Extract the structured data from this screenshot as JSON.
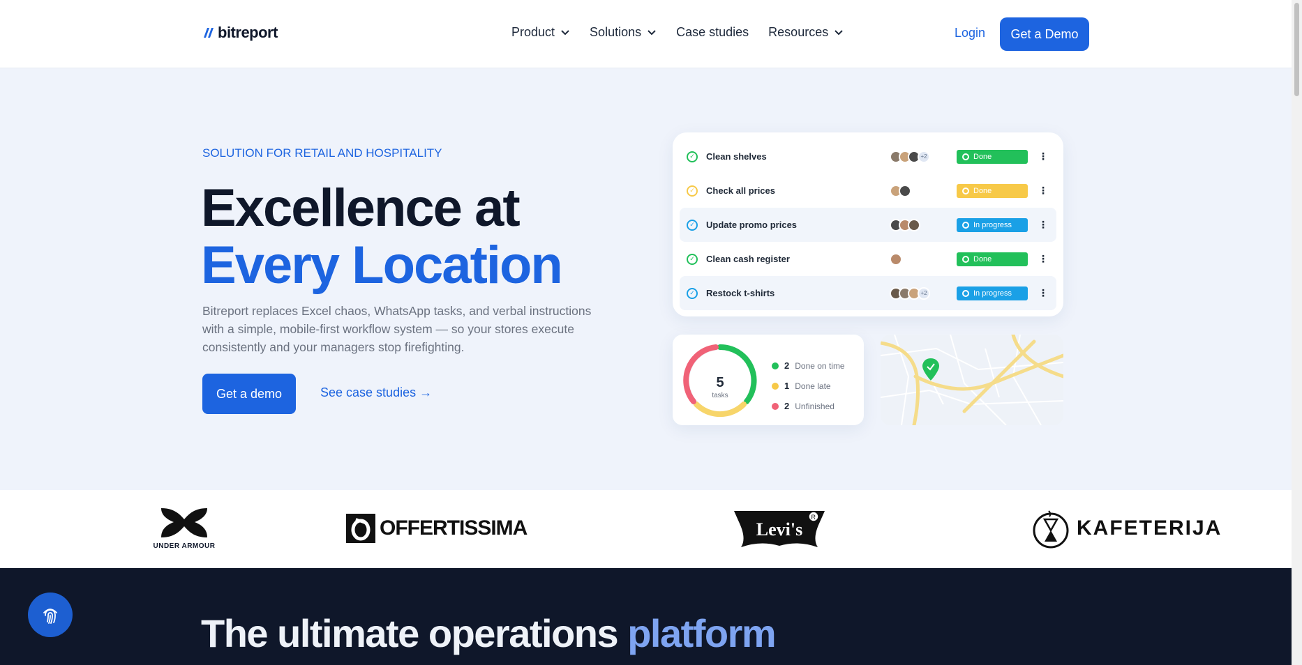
{
  "brand": {
    "logo_text": "bitreport"
  },
  "nav": {
    "items": [
      {
        "label": "Product",
        "dropdown": true
      },
      {
        "label": "Solutions",
        "dropdown": true
      },
      {
        "label": "Case studies",
        "dropdown": false
      },
      {
        "label": "Resources",
        "dropdown": true
      }
    ],
    "login": "Login",
    "demo": "Get a Demo"
  },
  "hero": {
    "eyebrow": "SOLUTION FOR RETAIL AND HOSPITALITY",
    "headline_line1": "Excellence at",
    "headline_line2": "Every Location",
    "lede": "Bitreport replaces Excel chaos, WhatsApp tasks, and verbal instructions with a simple, mobile-first workflow system — so your stores execute consistently and your managers stop firefighting.",
    "primary_cta": "Get a demo",
    "secondary_cta": "See case studies →"
  },
  "tasks": [
    {
      "name": "Clean shelves",
      "status": "Done",
      "status_color": "#22c05a",
      "check_color": "#22c05a",
      "avatars": 3,
      "more": "+2",
      "highlight": false
    },
    {
      "name": "Check all prices",
      "status": "Done",
      "status_color": "#f7c948",
      "check_color": "#f7c948",
      "avatars": 2,
      "more": "",
      "highlight": false
    },
    {
      "name": "Update promo prices",
      "status": "In progress",
      "status_color": "#1aa0e6",
      "check_color": "#1aa0e6",
      "avatars": 3,
      "more": "",
      "highlight": true
    },
    {
      "name": "Clean cash register",
      "status": "Done",
      "status_color": "#22c05a",
      "check_color": "#22c05a",
      "avatars": 1,
      "more": "",
      "highlight": false
    },
    {
      "name": "Restock t-shirts",
      "status": "In progress",
      "status_color": "#1aa0e6",
      "check_color": "#1aa0e6",
      "avatars": 3,
      "more": "+2",
      "highlight": true
    }
  ],
  "summary": {
    "total": "5",
    "total_label": "tasks",
    "items": [
      {
        "count": "2",
        "label": "Done on time",
        "color": "#22c05a"
      },
      {
        "count": "1",
        "label": "Done late",
        "color": "#f7c948"
      },
      {
        "count": "2",
        "label": "Unfinished",
        "color": "#f06277"
      }
    ]
  },
  "logos": {
    "under_armour": "UNDER ARMOUR",
    "offertissima": "OFFERTISSIMA",
    "levis": "Levi's",
    "kafeterija": "KAFETERIJA"
  },
  "section": {
    "title_plain": "The ultimate operations",
    "title_accent": "platform"
  },
  "colors": {
    "accent": "#1d64e0",
    "dark": "#0f172a",
    "hero_bg": "#eff3fb"
  },
  "icons": {
    "chevron": "chevron-down-icon",
    "fingerprint": "fingerprint-icon",
    "check": "check-circle-icon",
    "more": "more-vertical-icon",
    "pin": "map-pin-icon"
  }
}
